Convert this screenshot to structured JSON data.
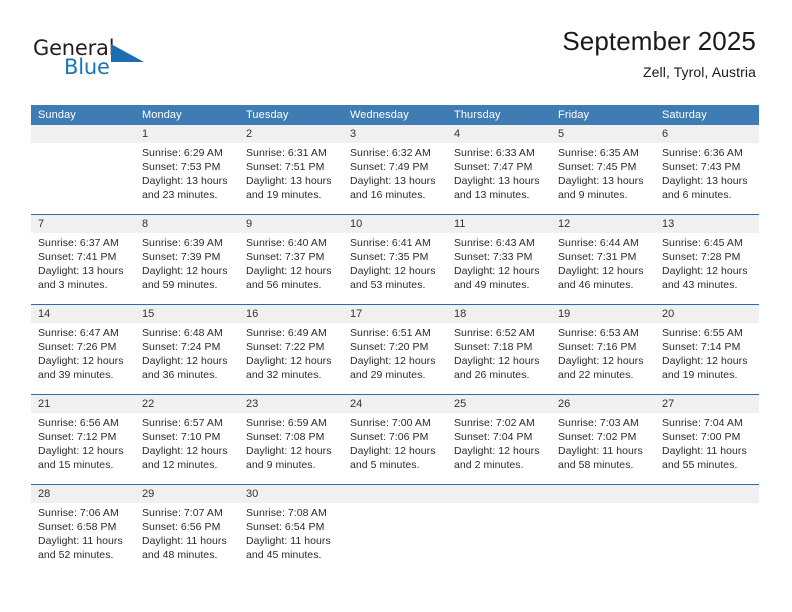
{
  "logo": {
    "word_one": "General",
    "word_two": "Blue",
    "triangle_color": "#1b6cb0"
  },
  "header": {
    "title": "September 2025",
    "subtitle": "Zell, Tyrol, Austria"
  },
  "theme": {
    "header_bar": "#3f7cb4",
    "week_divider": "#2b6ca8",
    "day_strip": "#f0f0f0",
    "logo_blue": "#1b75bb"
  },
  "weekdays": [
    "Sunday",
    "Monday",
    "Tuesday",
    "Wednesday",
    "Thursday",
    "Friday",
    "Saturday"
  ],
  "weeks": [
    [
      {
        "day": "",
        "empty": true
      },
      {
        "day": "1",
        "sunrise": "Sunrise: 6:29 AM",
        "sunset": "Sunset: 7:53 PM",
        "daylight1": "Daylight: 13 hours",
        "daylight2": "and 23 minutes."
      },
      {
        "day": "2",
        "sunrise": "Sunrise: 6:31 AM",
        "sunset": "Sunset: 7:51 PM",
        "daylight1": "Daylight: 13 hours",
        "daylight2": "and 19 minutes."
      },
      {
        "day": "3",
        "sunrise": "Sunrise: 6:32 AM",
        "sunset": "Sunset: 7:49 PM",
        "daylight1": "Daylight: 13 hours",
        "daylight2": "and 16 minutes."
      },
      {
        "day": "4",
        "sunrise": "Sunrise: 6:33 AM",
        "sunset": "Sunset: 7:47 PM",
        "daylight1": "Daylight: 13 hours",
        "daylight2": "and 13 minutes."
      },
      {
        "day": "5",
        "sunrise": "Sunrise: 6:35 AM",
        "sunset": "Sunset: 7:45 PM",
        "daylight1": "Daylight: 13 hours",
        "daylight2": "and 9 minutes."
      },
      {
        "day": "6",
        "sunrise": "Sunrise: 6:36 AM",
        "sunset": "Sunset: 7:43 PM",
        "daylight1": "Daylight: 13 hours",
        "daylight2": "and 6 minutes."
      }
    ],
    [
      {
        "day": "7",
        "sunrise": "Sunrise: 6:37 AM",
        "sunset": "Sunset: 7:41 PM",
        "daylight1": "Daylight: 13 hours",
        "daylight2": "and 3 minutes."
      },
      {
        "day": "8",
        "sunrise": "Sunrise: 6:39 AM",
        "sunset": "Sunset: 7:39 PM",
        "daylight1": "Daylight: 12 hours",
        "daylight2": "and 59 minutes."
      },
      {
        "day": "9",
        "sunrise": "Sunrise: 6:40 AM",
        "sunset": "Sunset: 7:37 PM",
        "daylight1": "Daylight: 12 hours",
        "daylight2": "and 56 minutes."
      },
      {
        "day": "10",
        "sunrise": "Sunrise: 6:41 AM",
        "sunset": "Sunset: 7:35 PM",
        "daylight1": "Daylight: 12 hours",
        "daylight2": "and 53 minutes."
      },
      {
        "day": "11",
        "sunrise": "Sunrise: 6:43 AM",
        "sunset": "Sunset: 7:33 PM",
        "daylight1": "Daylight: 12 hours",
        "daylight2": "and 49 minutes."
      },
      {
        "day": "12",
        "sunrise": "Sunrise: 6:44 AM",
        "sunset": "Sunset: 7:31 PM",
        "daylight1": "Daylight: 12 hours",
        "daylight2": "and 46 minutes."
      },
      {
        "day": "13",
        "sunrise": "Sunrise: 6:45 AM",
        "sunset": "Sunset: 7:28 PM",
        "daylight1": "Daylight: 12 hours",
        "daylight2": "and 43 minutes."
      }
    ],
    [
      {
        "day": "14",
        "sunrise": "Sunrise: 6:47 AM",
        "sunset": "Sunset: 7:26 PM",
        "daylight1": "Daylight: 12 hours",
        "daylight2": "and 39 minutes."
      },
      {
        "day": "15",
        "sunrise": "Sunrise: 6:48 AM",
        "sunset": "Sunset: 7:24 PM",
        "daylight1": "Daylight: 12 hours",
        "daylight2": "and 36 minutes."
      },
      {
        "day": "16",
        "sunrise": "Sunrise: 6:49 AM",
        "sunset": "Sunset: 7:22 PM",
        "daylight1": "Daylight: 12 hours",
        "daylight2": "and 32 minutes."
      },
      {
        "day": "17",
        "sunrise": "Sunrise: 6:51 AM",
        "sunset": "Sunset: 7:20 PM",
        "daylight1": "Daylight: 12 hours",
        "daylight2": "and 29 minutes."
      },
      {
        "day": "18",
        "sunrise": "Sunrise: 6:52 AM",
        "sunset": "Sunset: 7:18 PM",
        "daylight1": "Daylight: 12 hours",
        "daylight2": "and 26 minutes."
      },
      {
        "day": "19",
        "sunrise": "Sunrise: 6:53 AM",
        "sunset": "Sunset: 7:16 PM",
        "daylight1": "Daylight: 12 hours",
        "daylight2": "and 22 minutes."
      },
      {
        "day": "20",
        "sunrise": "Sunrise: 6:55 AM",
        "sunset": "Sunset: 7:14 PM",
        "daylight1": "Daylight: 12 hours",
        "daylight2": "and 19 minutes."
      }
    ],
    [
      {
        "day": "21",
        "sunrise": "Sunrise: 6:56 AM",
        "sunset": "Sunset: 7:12 PM",
        "daylight1": "Daylight: 12 hours",
        "daylight2": "and 15 minutes."
      },
      {
        "day": "22",
        "sunrise": "Sunrise: 6:57 AM",
        "sunset": "Sunset: 7:10 PM",
        "daylight1": "Daylight: 12 hours",
        "daylight2": "and 12 minutes."
      },
      {
        "day": "23",
        "sunrise": "Sunrise: 6:59 AM",
        "sunset": "Sunset: 7:08 PM",
        "daylight1": "Daylight: 12 hours",
        "daylight2": "and 9 minutes."
      },
      {
        "day": "24",
        "sunrise": "Sunrise: 7:00 AM",
        "sunset": "Sunset: 7:06 PM",
        "daylight1": "Daylight: 12 hours",
        "daylight2": "and 5 minutes."
      },
      {
        "day": "25",
        "sunrise": "Sunrise: 7:02 AM",
        "sunset": "Sunset: 7:04 PM",
        "daylight1": "Daylight: 12 hours",
        "daylight2": "and 2 minutes."
      },
      {
        "day": "26",
        "sunrise": "Sunrise: 7:03 AM",
        "sunset": "Sunset: 7:02 PM",
        "daylight1": "Daylight: 11 hours",
        "daylight2": "and 58 minutes."
      },
      {
        "day": "27",
        "sunrise": "Sunrise: 7:04 AM",
        "sunset": "Sunset: 7:00 PM",
        "daylight1": "Daylight: 11 hours",
        "daylight2": "and 55 minutes."
      }
    ],
    [
      {
        "day": "28",
        "sunrise": "Sunrise: 7:06 AM",
        "sunset": "Sunset: 6:58 PM",
        "daylight1": "Daylight: 11 hours",
        "daylight2": "and 52 minutes."
      },
      {
        "day": "29",
        "sunrise": "Sunrise: 7:07 AM",
        "sunset": "Sunset: 6:56 PM",
        "daylight1": "Daylight: 11 hours",
        "daylight2": "and 48 minutes."
      },
      {
        "day": "30",
        "sunrise": "Sunrise: 7:08 AM",
        "sunset": "Sunset: 6:54 PM",
        "daylight1": "Daylight: 11 hours",
        "daylight2": "and 45 minutes."
      },
      {
        "day": "",
        "empty": true
      },
      {
        "day": "",
        "empty": true
      },
      {
        "day": "",
        "empty": true
      },
      {
        "day": "",
        "empty": true
      }
    ]
  ]
}
